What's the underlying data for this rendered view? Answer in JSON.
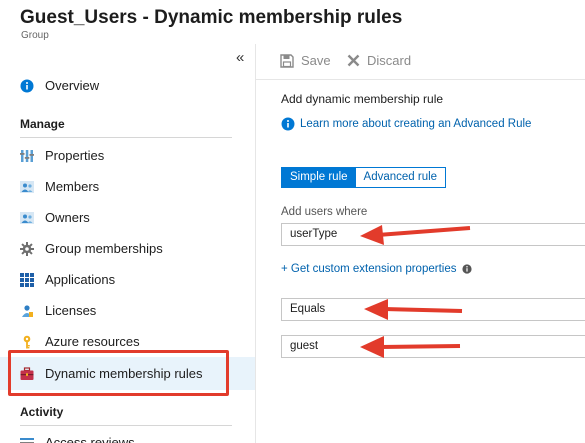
{
  "header": {
    "title": "Guest_Users - Dynamic membership rules",
    "subtitle": "Group"
  },
  "sidebar": {
    "collapse_glyph": "«",
    "overview": {
      "label": "Overview",
      "icon": "info-icon"
    },
    "manage_label": "Manage",
    "items": [
      {
        "label": "Properties",
        "icon": "properties-icon"
      },
      {
        "label": "Members",
        "icon": "members-icon"
      },
      {
        "label": "Owners",
        "icon": "owners-icon"
      },
      {
        "label": "Group memberships",
        "icon": "gear-icon"
      },
      {
        "label": "Applications",
        "icon": "grid-icon"
      },
      {
        "label": "Licenses",
        "icon": "license-icon"
      },
      {
        "label": "Azure resources",
        "icon": "key-icon"
      },
      {
        "label": "Dynamic membership rules",
        "icon": "toolbox-icon",
        "active": true
      }
    ],
    "activity_label": "Activity",
    "partial_item": {
      "label": "Access reviews",
      "icon": "list-icon"
    }
  },
  "toolbar": {
    "save_label": "Save",
    "discard_label": "Discard"
  },
  "main": {
    "heading": "Add dynamic membership rule",
    "learn_link": "Learn more about creating an Advanced Rule",
    "tabs": {
      "simple": "Simple rule",
      "advanced": "Advanced rule",
      "selected": "Simple rule"
    },
    "add_users_label": "Add users where",
    "property_value": "userType",
    "custom_link": "+ Get custom extension properties",
    "operator_value": "Equals",
    "value_value": "guest"
  },
  "colors": {
    "accent": "#0078d4",
    "annotation": "#e23b2b",
    "active_bg": "#e8f3fb"
  }
}
